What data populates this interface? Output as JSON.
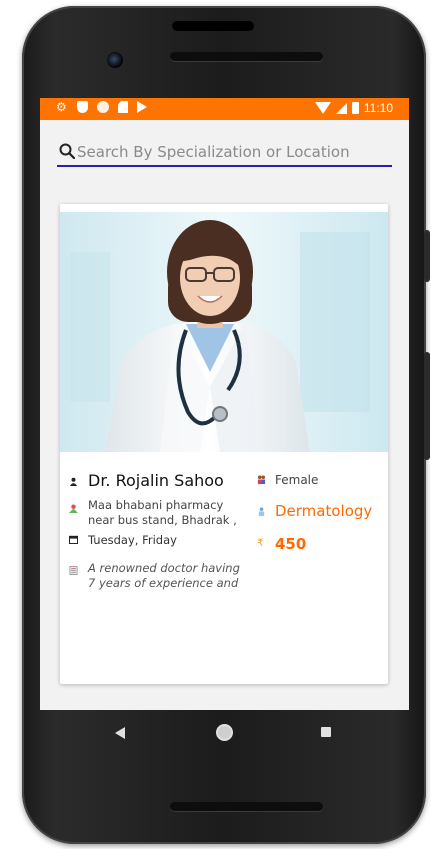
{
  "status_bar": {
    "time": "11:10",
    "color": "#ff7300",
    "left_icons": [
      "settings-icon",
      "shield-icon",
      "circle-icon",
      "sd-card-icon",
      "play-icon"
    ],
    "right_icons": [
      "wifi-icon",
      "signal-icon",
      "battery-icon"
    ]
  },
  "search": {
    "placeholder": "Search By Specialization or Location",
    "icon": "search-icon",
    "underline_color": "#2a1ab8"
  },
  "doctor_card": {
    "name": "Dr. Rojalin Sahoo",
    "address": "Maa bhabani pharmacy near bus stand, Bhadrak ,",
    "days": "Tuesday, Friday",
    "description": "A renowned doctor having 7 years of experience and",
    "gender": "Female",
    "specialization": "Dermatology",
    "fee": "450",
    "accent_color": "#ff6a00"
  },
  "nav_bar": {
    "buttons": [
      "back-icon",
      "home-icon",
      "recents-icon"
    ]
  }
}
